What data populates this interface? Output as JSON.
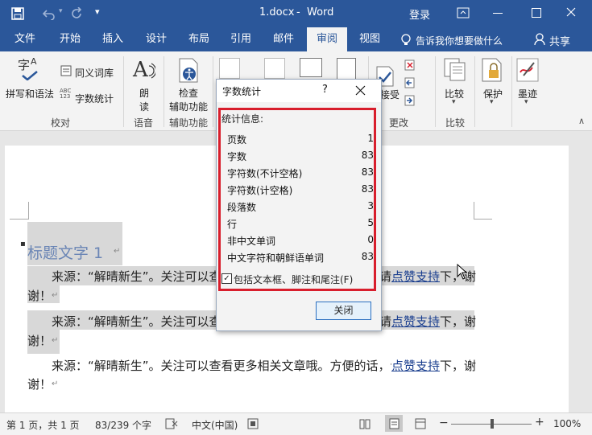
{
  "titlebar": {
    "filename": "1.docx",
    "separator": "-",
    "app": "Word",
    "login": "登录"
  },
  "tabs": [
    {
      "label": "文件"
    },
    {
      "label": "开始"
    },
    {
      "label": "插入"
    },
    {
      "label": "设计"
    },
    {
      "label": "布局"
    },
    {
      "label": "引用"
    },
    {
      "label": "邮件"
    },
    {
      "label": "审阅"
    },
    {
      "label": "视图"
    }
  ],
  "tell_me": "告诉我你想要做什么",
  "share": "共享",
  "ribbon": {
    "spelling": "拼写和语法",
    "thesaurus": "同义词库",
    "wordcount": "字数统计",
    "read_aloud_1": "朗",
    "read_aloud_2": "读",
    "check_acc_1": "检查",
    "check_acc_2": "辅助功能",
    "accept_partial": "接受",
    "compare": "比较",
    "protect": "保护",
    "ink": "墨迹",
    "groups": {
      "proofing": "校对",
      "speech": "语音",
      "accessibility": "辅助功能",
      "changes": "更改",
      "compare": "比较"
    }
  },
  "document": {
    "heading": "标题文字 1",
    "para_text": "来源：“解晴新生”。关注可以查看更多相关文章哦。方便的话，请",
    "para_link": "点赞支持",
    "para_tail": "下，谢",
    "para_end": "谢！",
    "para_partial_left": "来源：“解晴新生”。关注可以查",
    "para_partial_right_pre": "请",
    "para_partial_right_tail": "下，谢"
  },
  "dialog": {
    "title": "字数统计",
    "help": "?",
    "stats_header": "统计信息:",
    "stats": [
      {
        "label": "页数",
        "value": "1"
      },
      {
        "label": "字数",
        "value": "83"
      },
      {
        "label": "字符数(不计空格)",
        "value": "83"
      },
      {
        "label": "字符数(计空格)",
        "value": "83"
      },
      {
        "label": "段落数",
        "value": "3"
      },
      {
        "label": "行",
        "value": "5"
      },
      {
        "label": "非中文单词",
        "value": "0"
      },
      {
        "label": "中文字符和朝鲜语单词",
        "value": "83"
      }
    ],
    "include_label": "包括文本框、脚注和尾注(F)",
    "include_checked": true,
    "close_label": "关闭"
  },
  "status": {
    "page": "第 1 页，共 1 页",
    "words": "83/239 个字",
    "language": "中文(中国)",
    "zoom": "100%"
  },
  "colors": {
    "accent": "#2b579a",
    "highlight_box": "#d81e2c"
  }
}
